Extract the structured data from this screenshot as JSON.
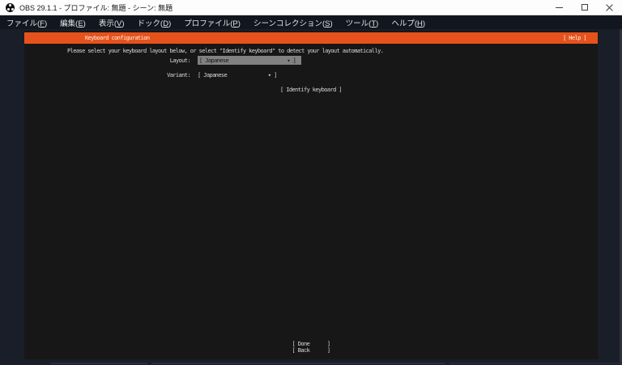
{
  "window": {
    "title": "OBS 29.1.1 - プロファイル: 無題 - シーン: 無題"
  },
  "menu": {
    "items": [
      {
        "pre": "ファイル(",
        "accel": "F",
        "post": ")"
      },
      {
        "pre": "編集(",
        "accel": "E",
        "post": ")"
      },
      {
        "pre": "表示(",
        "accel": "V",
        "post": ")"
      },
      {
        "pre": "ドック(",
        "accel": "D",
        "post": ")"
      },
      {
        "pre": "プロファイル(",
        "accel": "P",
        "post": ")"
      },
      {
        "pre": "シーンコレクション(",
        "accel": "S",
        "post": ")"
      },
      {
        "pre": "ツール(",
        "accel": "T",
        "post": ")"
      },
      {
        "pre": "ヘルプ(",
        "accel": "H",
        "post": ")"
      }
    ]
  },
  "installer": {
    "header": {
      "title": "Keyboard configuration",
      "help_label": "[ Help ]"
    },
    "instruction": "Please select your keyboard layout below, or select \"Identify keyboard\" to detect your layout automatically.",
    "layout_field": {
      "label": "Layout:",
      "value": "[ Japanese                    ▾ ]"
    },
    "variant_field": {
      "label": "Variant:",
      "value": "[ Japanese              ▾ ]"
    },
    "identify_button": "[ Identify keyboard ]",
    "done_button": "[ Done      ]",
    "back_button": "[ Back      ]"
  },
  "icons": {
    "obs_logo": "obs-logo-icon",
    "minimize": "minimize-icon",
    "maximize": "maximize-icon",
    "close": "close-icon",
    "dropdown_arrow": "▾"
  },
  "colors": {
    "ubuntu_orange": "#e6521c",
    "focus_gray": "#818181",
    "titlebar_bg": "#fdfdfd",
    "menubar_bg": "#12161f",
    "workspace_bg": "#191e29",
    "screen_bg": "#171717"
  }
}
